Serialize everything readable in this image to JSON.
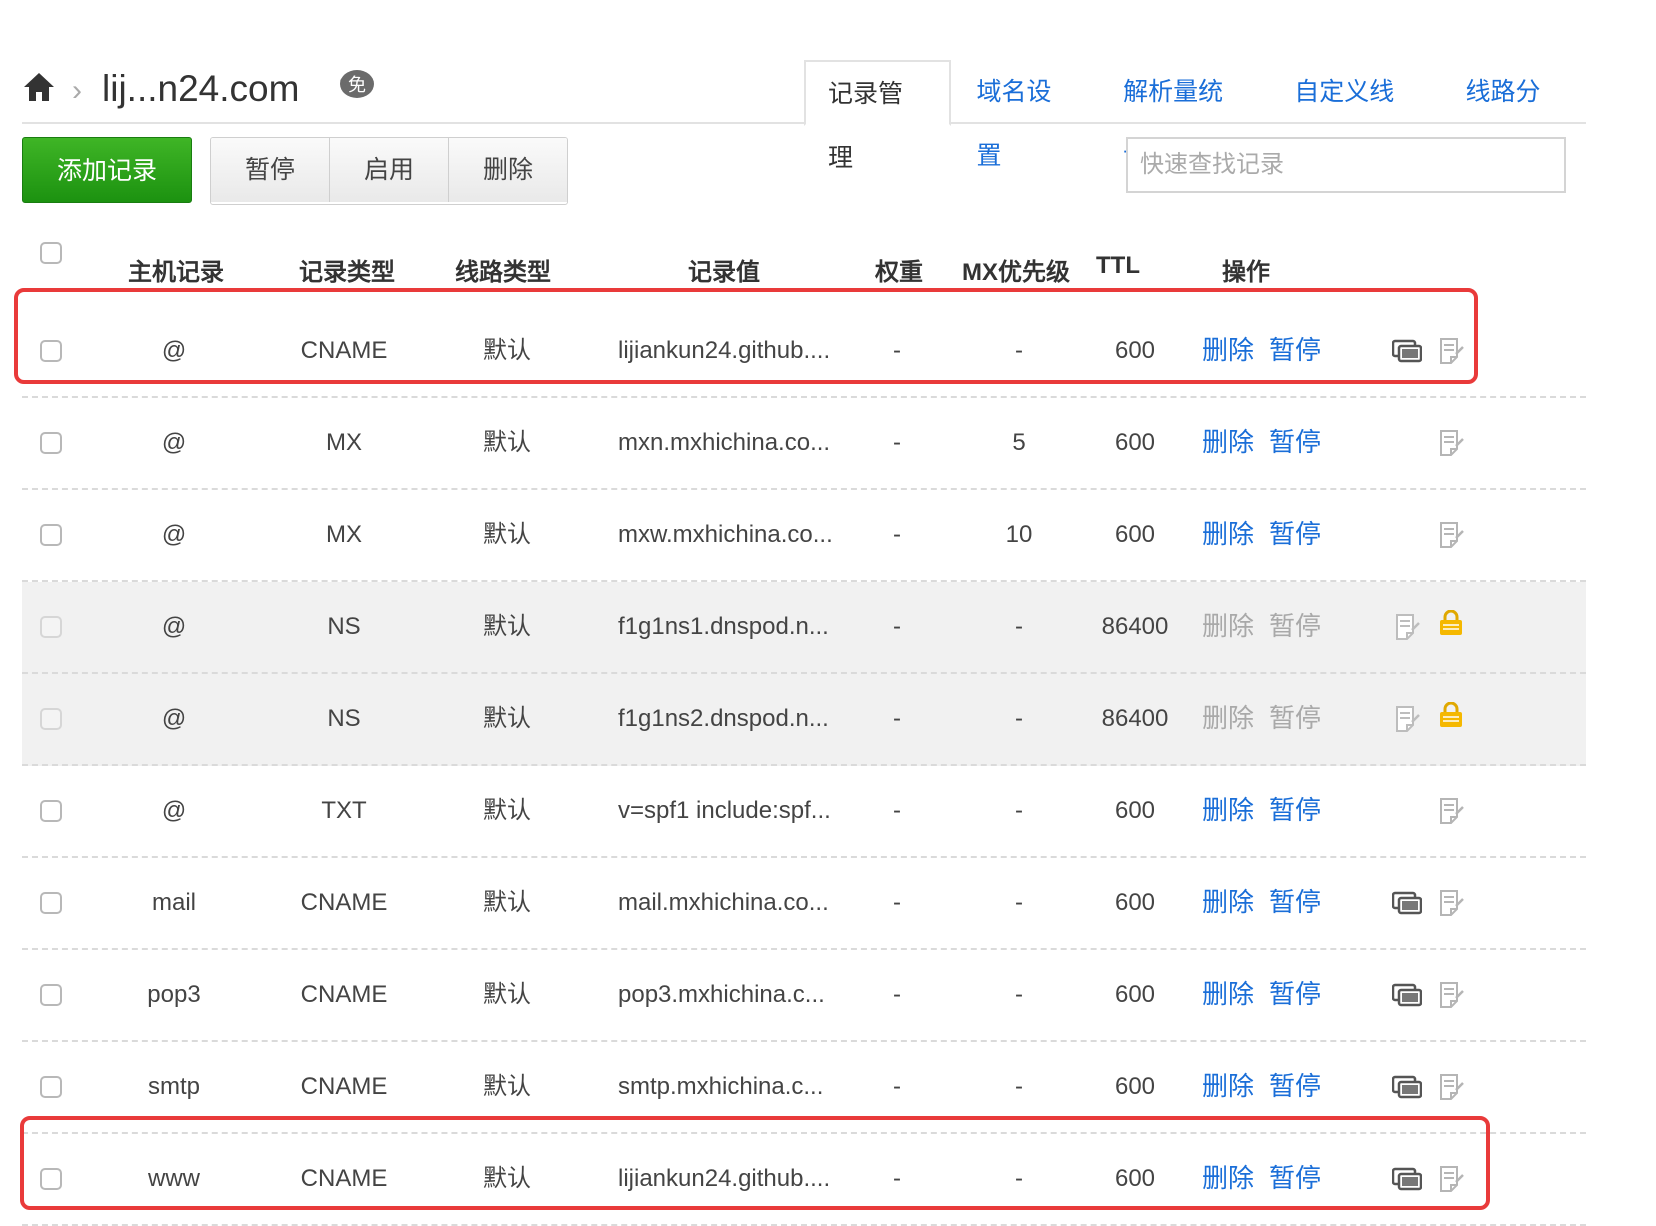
{
  "header": {
    "domain": "lij...n24.com",
    "badge": "免",
    "tabs": [
      "记录管理",
      "域名设置",
      "解析量统计",
      "自定义线路",
      "线路分组"
    ],
    "active_tab": 0
  },
  "toolbar": {
    "add_label": "添加记录",
    "pause_label": "暂停",
    "enable_label": "启用",
    "delete_label": "删除",
    "search_placeholder": "快速查找记录"
  },
  "table": {
    "headers": {
      "host": "主机记录",
      "type": "记录类型",
      "line": "线路类型",
      "value": "记录值",
      "weight": "权重",
      "mx": "MX优先级",
      "ttl": "TTL",
      "ops": "操作"
    },
    "rows": [
      {
        "host": "@",
        "type": "CNAME",
        "line": "默认",
        "value": "lijiankun24.github....",
        "weight": "-",
        "mx": "-",
        "ttl": "600",
        "del": "删除",
        "pause": "暂停",
        "system": false,
        "monitor": true,
        "lock": false,
        "highlight": true
      },
      {
        "host": "@",
        "type": "MX",
        "line": "默认",
        "value": "mxn.mxhichina.co...",
        "weight": "-",
        "mx": "5",
        "ttl": "600",
        "del": "删除",
        "pause": "暂停",
        "system": false,
        "monitor": false,
        "lock": false,
        "highlight": false
      },
      {
        "host": "@",
        "type": "MX",
        "line": "默认",
        "value": "mxw.mxhichina.co...",
        "weight": "-",
        "mx": "10",
        "ttl": "600",
        "del": "删除",
        "pause": "暂停",
        "system": false,
        "monitor": false,
        "lock": false,
        "highlight": false
      },
      {
        "host": "@",
        "type": "NS",
        "line": "默认",
        "value": "f1g1ns1.dnspod.n...",
        "weight": "-",
        "mx": "-",
        "ttl": "86400",
        "del": "删除",
        "pause": "暂停",
        "system": true,
        "monitor": false,
        "lock": true,
        "highlight": false
      },
      {
        "host": "@",
        "type": "NS",
        "line": "默认",
        "value": "f1g1ns2.dnspod.n...",
        "weight": "-",
        "mx": "-",
        "ttl": "86400",
        "del": "删除",
        "pause": "暂停",
        "system": true,
        "monitor": false,
        "lock": true,
        "highlight": false
      },
      {
        "host": "@",
        "type": "TXT",
        "line": "默认",
        "value": "v=spf1 include:spf...",
        "weight": "-",
        "mx": "-",
        "ttl": "600",
        "del": "删除",
        "pause": "暂停",
        "system": false,
        "monitor": false,
        "lock": false,
        "highlight": false
      },
      {
        "host": "mail",
        "type": "CNAME",
        "line": "默认",
        "value": "mail.mxhichina.co...",
        "weight": "-",
        "mx": "-",
        "ttl": "600",
        "del": "删除",
        "pause": "暂停",
        "system": false,
        "monitor": true,
        "lock": false,
        "highlight": false
      },
      {
        "host": "pop3",
        "type": "CNAME",
        "line": "默认",
        "value": "pop3.mxhichina.c...",
        "weight": "-",
        "mx": "-",
        "ttl": "600",
        "del": "删除",
        "pause": "暂停",
        "system": false,
        "monitor": true,
        "lock": false,
        "highlight": false
      },
      {
        "host": "smtp",
        "type": "CNAME",
        "line": "默认",
        "value": "smtp.mxhichina.c...",
        "weight": "-",
        "mx": "-",
        "ttl": "600",
        "del": "删除",
        "pause": "暂停",
        "system": false,
        "monitor": true,
        "lock": false,
        "highlight": false
      },
      {
        "host": "www",
        "type": "CNAME",
        "line": "默认",
        "value": "lijiankun24.github....",
        "weight": "-",
        "mx": "-",
        "ttl": "600",
        "del": "删除",
        "pause": "暂停",
        "system": false,
        "monitor": true,
        "lock": false,
        "highlight": true
      }
    ]
  },
  "colors": {
    "link": "#1a6ed8",
    "add_button": "#2aa31a",
    "highlight_border": "#e93a3a",
    "lock": "#f5b800"
  }
}
